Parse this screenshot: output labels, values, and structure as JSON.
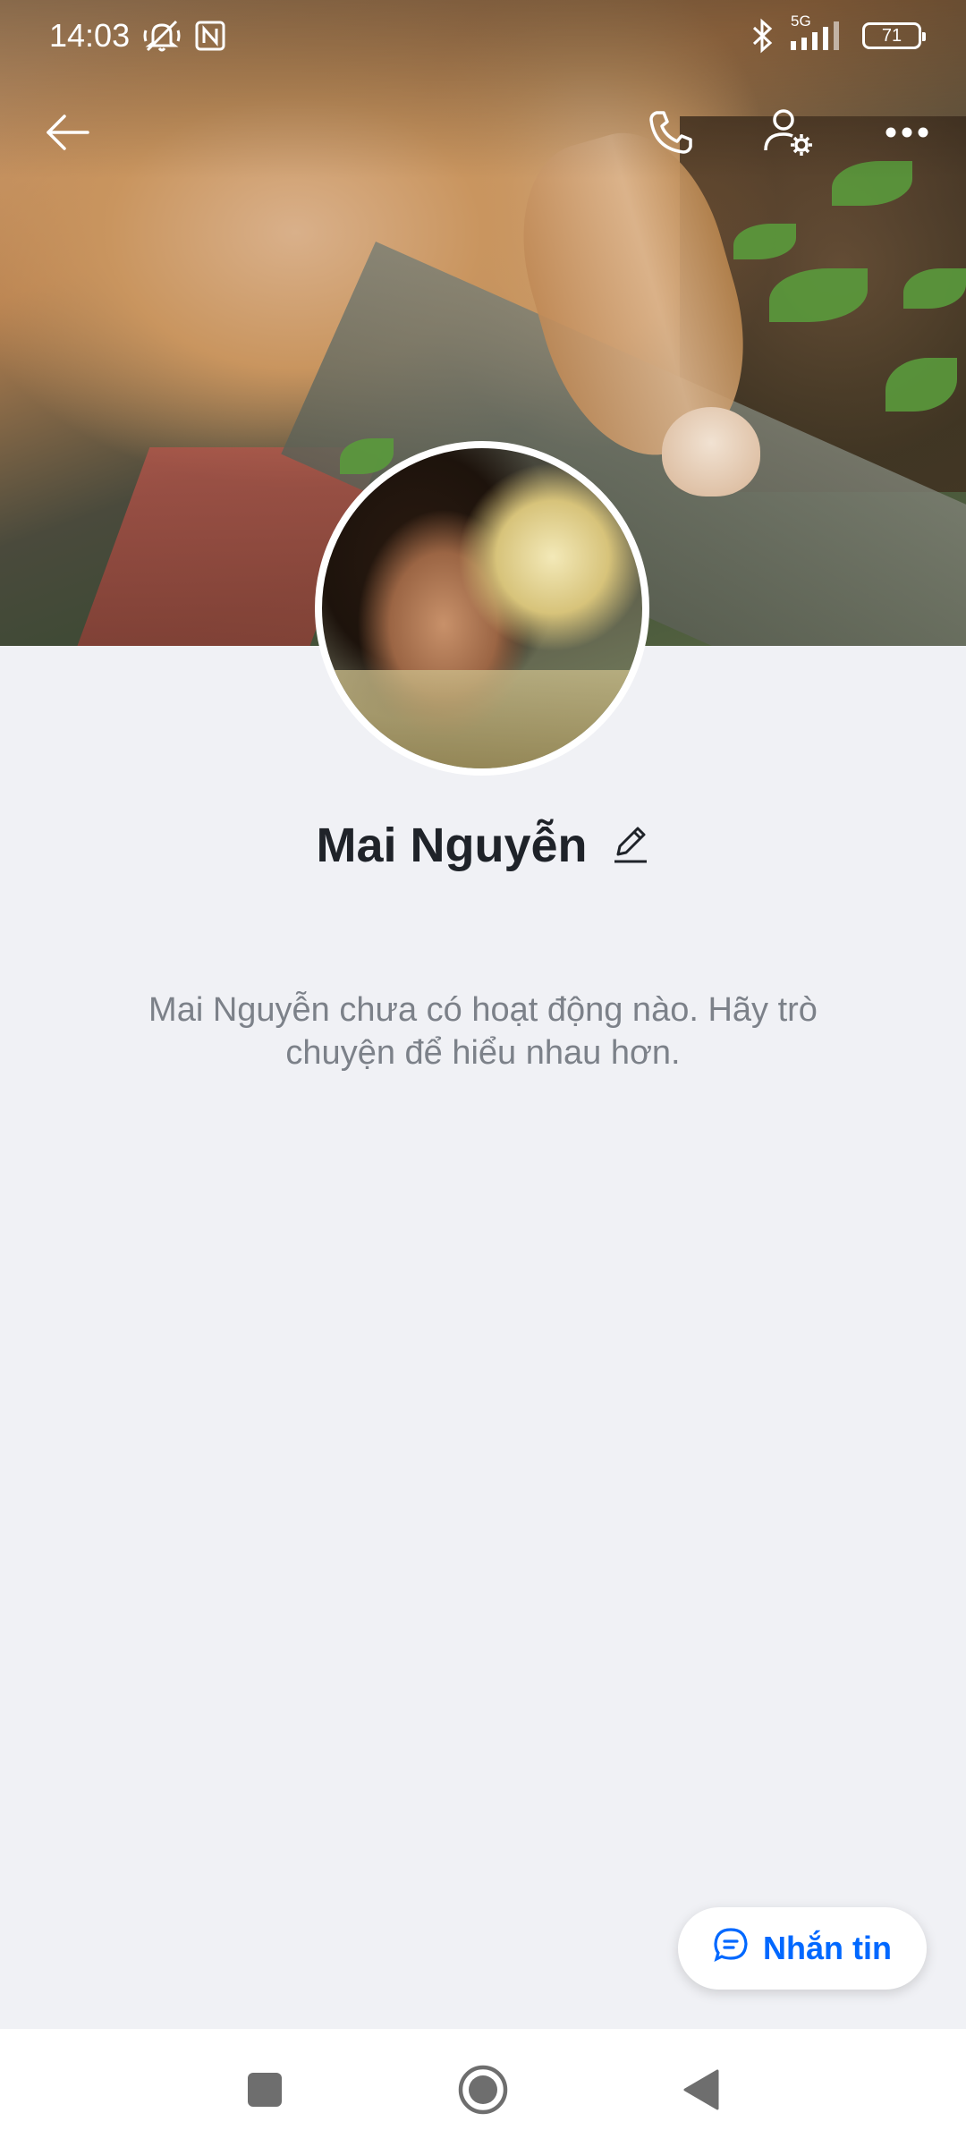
{
  "status_bar": {
    "time": "14:03",
    "network": "5G",
    "battery": "71",
    "icons": [
      "mute-icon",
      "nfc-icon",
      "bluetooth-icon",
      "signal-icon",
      "battery-icon"
    ]
  },
  "topbar": {
    "icons": [
      "back-arrow-icon",
      "phone-icon",
      "user-settings-icon",
      "more-icon"
    ]
  },
  "profile": {
    "name": "Mai Nguyễn",
    "empty_message": "Mai Nguyễn chưa có hoạt động nào. Hãy trò chuyện để hiểu nhau hơn."
  },
  "message_button": {
    "label": "Nhắn tin",
    "icon": "chat-bubble-icon"
  },
  "navbar": {
    "icons": [
      "recent-apps-icon",
      "home-icon",
      "back-icon"
    ]
  },
  "colors": {
    "accent": "#0068ff",
    "background": "#f0f1f5",
    "name_text": "#1f2329",
    "muted_text": "#7c8189"
  }
}
